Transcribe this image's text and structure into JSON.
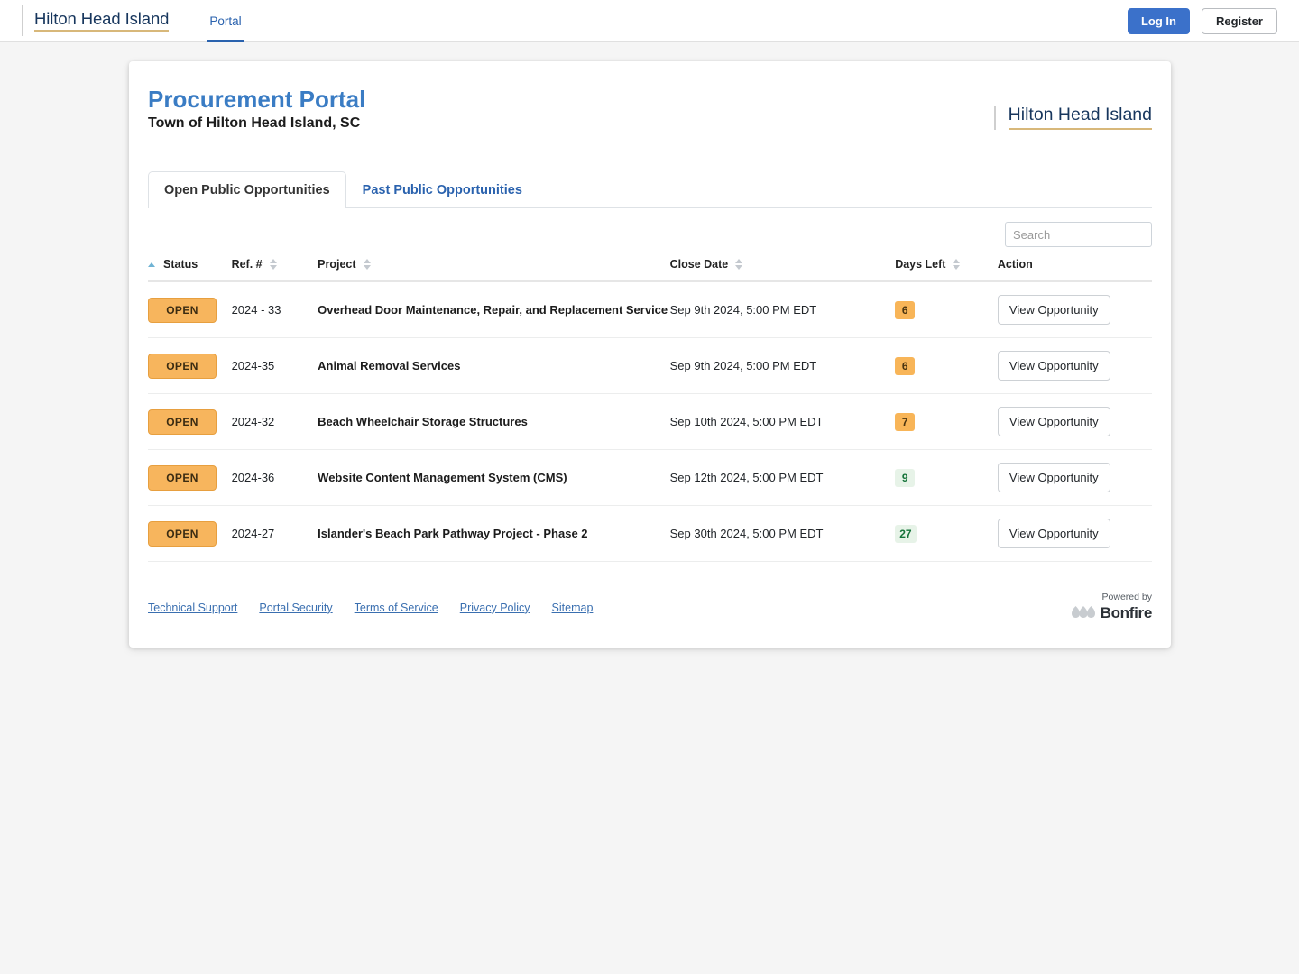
{
  "topbar": {
    "brand": "Hilton Head Island",
    "nav_items": [
      {
        "label": "Portal",
        "active": true
      }
    ],
    "login_label": "Log In",
    "register_label": "Register"
  },
  "header": {
    "title": "Procurement Portal",
    "subtitle": "Town of Hilton Head Island, SC",
    "logo_text": "Hilton Head Island"
  },
  "tabs": [
    {
      "label": "Open Public Opportunities",
      "active": true
    },
    {
      "label": "Past Public Opportunities",
      "active": false
    }
  ],
  "search": {
    "placeholder": "Search",
    "value": ""
  },
  "table": {
    "columns": [
      {
        "label": "Status",
        "sort": "asc"
      },
      {
        "label": "Ref. #",
        "sort": "none"
      },
      {
        "label": "Project",
        "sort": "none"
      },
      {
        "label": "Close Date",
        "sort": "none"
      },
      {
        "label": "Days Left",
        "sort": "none"
      },
      {
        "label": "Action",
        "sort": null
      }
    ],
    "action_label": "View Opportunity",
    "rows": [
      {
        "status": "OPEN",
        "ref": "2024 - 33",
        "project": "Overhead Door Maintenance, Repair, and Replacement Service",
        "close_date": "Sep 9th 2024, 5:00 PM EDT",
        "days_left": "6",
        "days_level": "warn"
      },
      {
        "status": "OPEN",
        "ref": "2024-35",
        "project": "Animal Removal Services",
        "close_date": "Sep 9th 2024, 5:00 PM EDT",
        "days_left": "6",
        "days_level": "warn"
      },
      {
        "status": "OPEN",
        "ref": "2024-32",
        "project": "Beach Wheelchair Storage Structures",
        "close_date": "Sep 10th 2024, 5:00 PM EDT",
        "days_left": "7",
        "days_level": "warn"
      },
      {
        "status": "OPEN",
        "ref": "2024-36",
        "project": "Website Content Management System (CMS)",
        "close_date": "Sep 12th 2024, 5:00 PM EDT",
        "days_left": "9",
        "days_level": "ok"
      },
      {
        "status": "OPEN",
        "ref": "2024-27",
        "project": "Islander's Beach Park Pathway Project - Phase 2",
        "close_date": "Sep 30th 2024, 5:00 PM EDT",
        "days_left": "27",
        "days_level": "ok"
      }
    ]
  },
  "footer": {
    "links": [
      "Technical Support",
      "Portal Security",
      "Terms of Service",
      "Privacy Policy",
      "Sitemap"
    ],
    "powered_by_label": "Powered by",
    "powered_by_brand": "Bonfire"
  },
  "colors": {
    "accent_blue": "#2a62ae",
    "title_blue": "#3a7cc4",
    "brand_navy": "#17365d",
    "brand_gold": "#d8b87a",
    "status_open": "#f7b55d",
    "days_warn": "#f8b558",
    "days_ok_bg": "#e7f3e8",
    "days_ok_text": "#16743a",
    "page_bg": "#f5f5f5"
  }
}
